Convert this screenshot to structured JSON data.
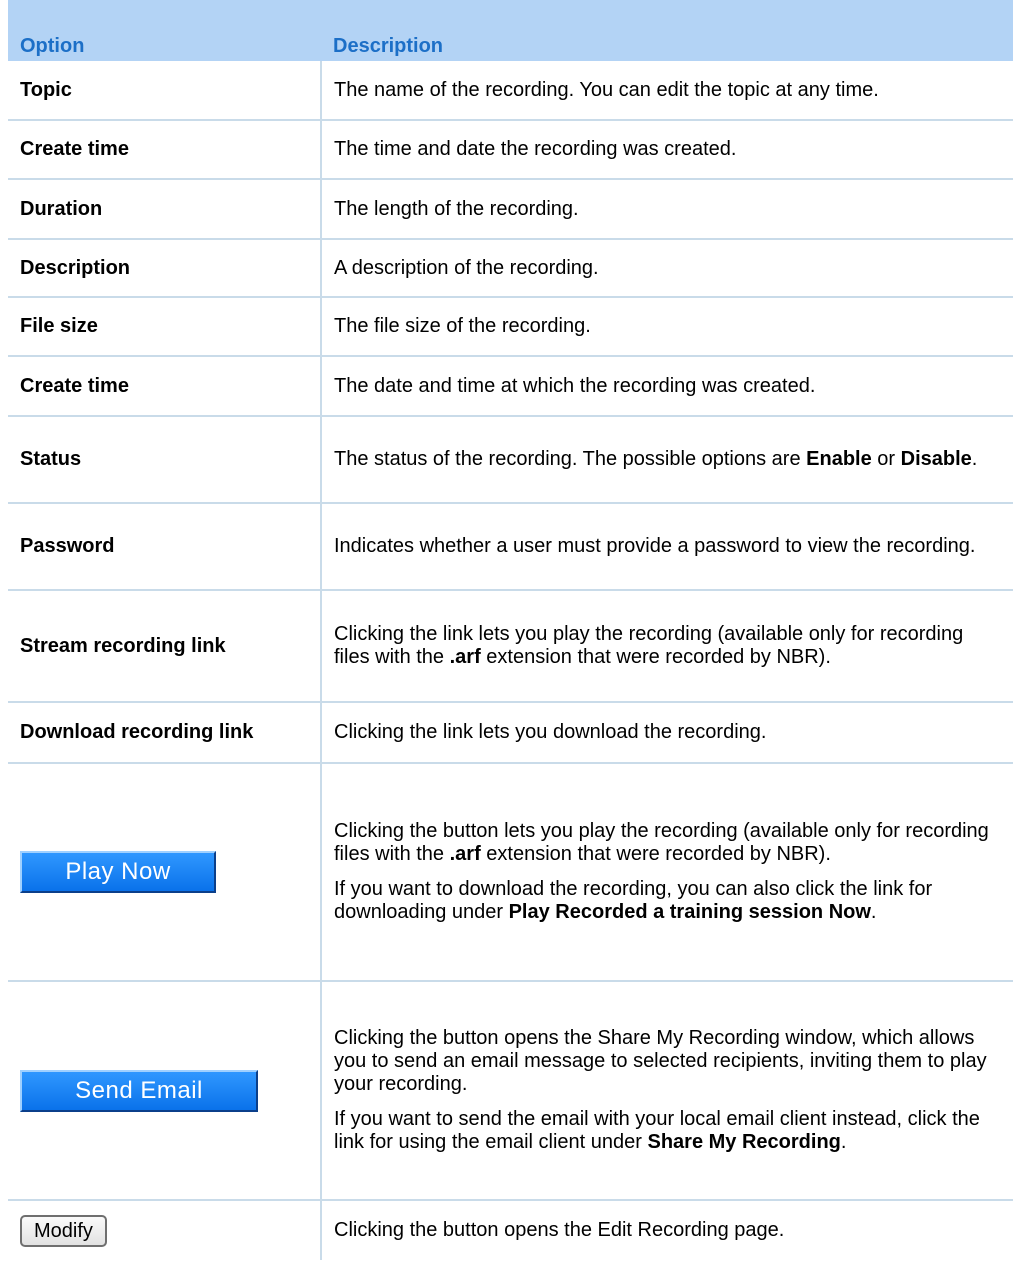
{
  "header": {
    "option": "Option",
    "description": "Description"
  },
  "rows": [
    {
      "option": "Topic",
      "description": "The name of the recording. You can edit the topic at any time."
    },
    {
      "option": "Create time",
      "description": "The time and date the recording was created."
    },
    {
      "option": "Duration",
      "description": "The length of the recording."
    },
    {
      "option": "Description",
      "description": "A description of the recording."
    },
    {
      "option": "File size",
      "description": "The file size of the recording."
    },
    {
      "option": "Create time",
      "description": "The date and time at which the recording was created."
    },
    {
      "option": "Status",
      "desc_parts": [
        "The status of the recording. The possible options are ",
        "Enable",
        " or ",
        "Disable",
        "."
      ]
    },
    {
      "option": "Password",
      "description": "Indicates whether a user must provide a password to view the recording."
    },
    {
      "option": "Stream recording link",
      "desc_parts": [
        "Clicking the link lets you play the recording (available only for recording files with the ",
        ".arf",
        " extension that were recorded by NBR)."
      ]
    },
    {
      "option": "Download recording link",
      "description": "Clicking the link lets you download the recording."
    },
    {
      "button_label": "Play Now",
      "p1_parts": [
        "Clicking the button lets you play the recording (available only for recording files with the ",
        ".arf",
        " extension that were recorded by NBR)."
      ],
      "p2_parts": [
        "If you want to download the recording, you can also click the link for downloading under ",
        "Play Recorded a training session Now",
        "."
      ]
    },
    {
      "button_label": "Send Email",
      "p1": "Clicking the button opens the Share My Recording window, which allows you to send an email message to selected recipients, inviting them to play your recording.",
      "p2_parts": [
        "If you want to send the email with your local email client instead, click the link for using the email client under ",
        "Share My Recording",
        "."
      ]
    },
    {
      "button_label": "Modify",
      "description": "Clicking the button opens the Edit Recording page."
    }
  ],
  "colors": {
    "header_bg": "#b3d3f5",
    "header_text": "#1c6fc7",
    "rule": "#c9dbe9",
    "button_blue": "#0a72ea"
  }
}
